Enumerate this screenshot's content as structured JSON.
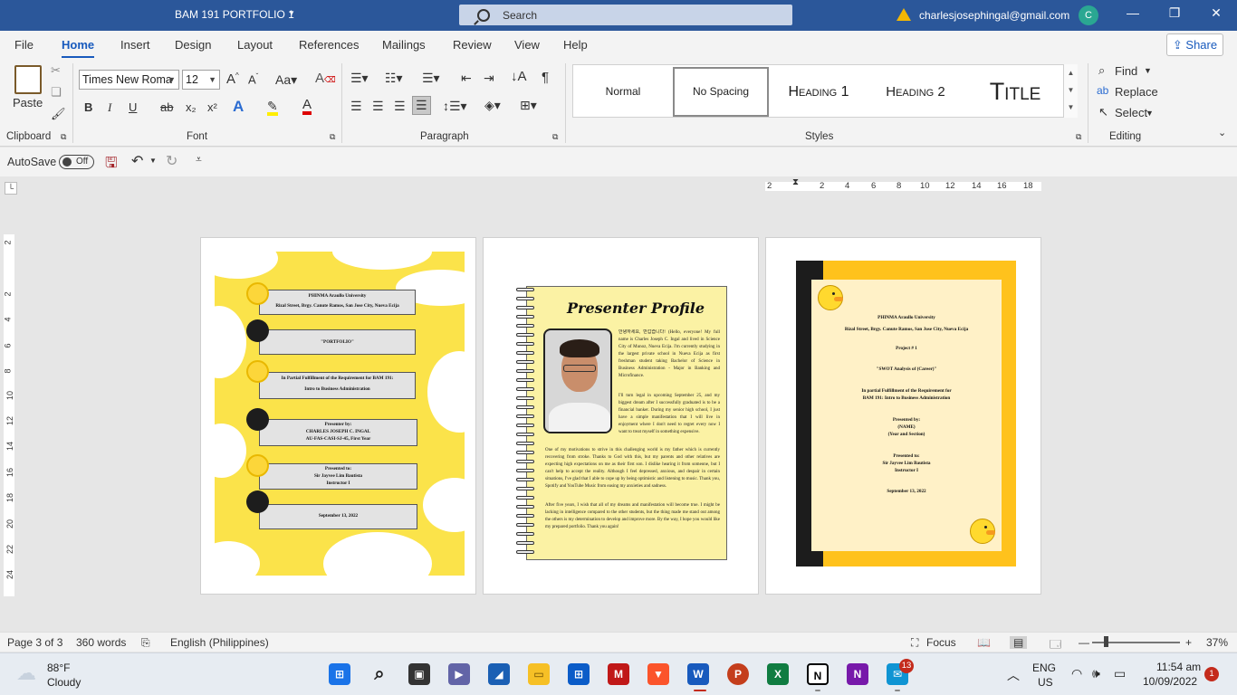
{
  "titlebar": {
    "doc_title": "BAM 191 PORTFOLIO 1",
    "search_label": "Search",
    "email": "charlesjosephingal@gmail.com",
    "avatar_initial": "C",
    "minimize": "—",
    "restore": "❐",
    "close": "✕"
  },
  "menu": {
    "tabs": [
      "File",
      "Home",
      "Insert",
      "Design",
      "Layout",
      "References",
      "Mailings",
      "Review",
      "View",
      "Help"
    ],
    "active": "Home",
    "share": "Share"
  },
  "ribbon": {
    "clipboard": {
      "paste": "Paste",
      "label": "Clipboard"
    },
    "font": {
      "family": "Times New Roma",
      "size": "12",
      "label": "Font",
      "bold": "B",
      "italic": "I",
      "underline": "U",
      "strike": "ab",
      "sub": "x₂",
      "sup": "x²"
    },
    "paragraph": {
      "label": "Paragraph",
      "pilcrow": "¶"
    },
    "styles": {
      "items": [
        "Normal",
        "No Spacing",
        "Heading 1",
        "Heading 2",
        "Title"
      ],
      "selected": "No Spacing",
      "label": "Styles"
    },
    "editing": {
      "find": "Find",
      "replace": "Replace",
      "select": "Select",
      "label": "Editing"
    }
  },
  "qat": {
    "autosave": "AutoSave",
    "autosave_state": "Off"
  },
  "ruler": {
    "horizontal": [
      "2",
      "2",
      "4",
      "6",
      "8",
      "10",
      "12",
      "14",
      "16",
      "18"
    ],
    "vertical": [
      "2",
      "2",
      "4",
      "6",
      "8",
      "10",
      "12",
      "14",
      "16",
      "18",
      "20",
      "22",
      "24"
    ]
  },
  "page1": {
    "university": "PHINMA Araullo University",
    "address": "Rizal Street, Brgy. Canute Ramos, San Jose City, Nueva Ecija",
    "portfolio": "\"PORTFOLIO\"",
    "fulfillment": "In Partial Fulfillment of the Requirement for BAM 191:",
    "course": "Intro to Business Administration",
    "presenter_by": "Presenter by:",
    "presenter_name": "CHARLES JOSEPH C. INGAL",
    "presenter_section": "AU-FAS-CASI-SJ-45, First Year",
    "presented_to": "Presented to:",
    "instructor_name": "Sir Jayvee Lim Bautista",
    "instructor_title": "Instructor I",
    "date": "September 13, 2022"
  },
  "page2": {
    "title": "Presenter Profile",
    "para1": "안녕하세요, 반갑습니다! (Hello, everyone! My full name is Charles Joseph C. Ingal and lived in Science City of Munoz, Nueva Ecija. I'm currently studying in the largest private school in Nueva Ecija as first freshman student taking Bachelor of Science in Business Administration - Major in Banking and Microfinance.",
    "para2": "I'll turn legal in upcoming September 25, and my biggest dream after I successfully graduated is to be a financial banker. During my senior high school, I just have a simple manifestation that I will live in enjoyment where I don't need to regret every now I want to treat myself in something expensive.",
    "para3": "One of my motivations to strive in this challenging world is my father which is currently recovering from stroke. Thanks to God with this, but my parents and other relatives are expecting high expectations on me as their first son. I dislike hearing it from someone, but I can't help to accept the reality. Although I feel depressed, anxious, and despair in certain situations, I've glad that I able to cope up by being optimistic and listening to music. Thank you, Spotify and YouTube Music from easing my anxieties and sadness.",
    "para4": "After five years, I wish that all of my dreams and manifestation will become true. I might be lacking in intelligence compared to the other students, but the thing made me stand out among the others is my determination to develop and improve more. By the way, I hope you would like my prepared portfolio. Thank you again!"
  },
  "page3": {
    "university": "PHINMA Araullo University",
    "address": "Rizal Street, Brgy. Canute Ramos, San Jose City, Nueva Ecija",
    "project": "Project # 1",
    "swot": "\"SWOT Analysis of (Career)\"",
    "fulfillment": "In partial Fulfillment of the Requirement for",
    "course": "BAM 191: Intro to Business Administration",
    "presented_by": "Presented by:",
    "name": "(NAME)",
    "year_section": "(Year and Section)",
    "presented_to": "Presented to:",
    "instructor_name": "Sir Jayvee Lim Bautista",
    "instructor_title": "Instructor I",
    "date": "September 13, 2022"
  },
  "statusbar": {
    "page": "Page 3 of 3",
    "words": "360 words",
    "language": "English (Philippines)",
    "focus": "Focus",
    "zoom": "37%"
  },
  "taskbar": {
    "weather_temp": "88°F",
    "weather_desc": "Cloudy",
    "lang1": "ENG",
    "lang2": "US",
    "time": "11:54 am",
    "date": "10/09/2022",
    "notif_count": "1",
    "badge_count": "13"
  }
}
